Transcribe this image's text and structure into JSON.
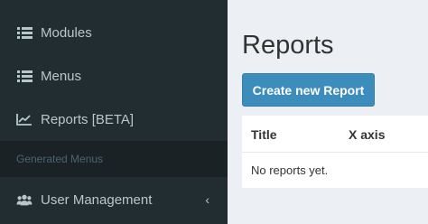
{
  "sidebar": {
    "items": [
      {
        "label": "Modules",
        "icon": "list-icon"
      },
      {
        "label": "Menus",
        "icon": "list-icon"
      },
      {
        "label": "Reports [BETA]",
        "icon": "line-chart-icon"
      }
    ],
    "section_header": "Generated Menus",
    "generated_items": [
      {
        "label": "User Management",
        "icon": "users-icon",
        "chevron": "‹"
      }
    ]
  },
  "main": {
    "title": "Reports",
    "create_button_label": "Create new Report",
    "table": {
      "columns": [
        "Title",
        "X axis"
      ],
      "empty_message": "No reports yet."
    }
  },
  "colors": {
    "sidebar_bg": "#222d32",
    "sidebar_text": "#b8c7ce",
    "section_header_bg": "#1a2226",
    "primary": "#3c8dbc",
    "content_bg": "#ecf0f5"
  }
}
